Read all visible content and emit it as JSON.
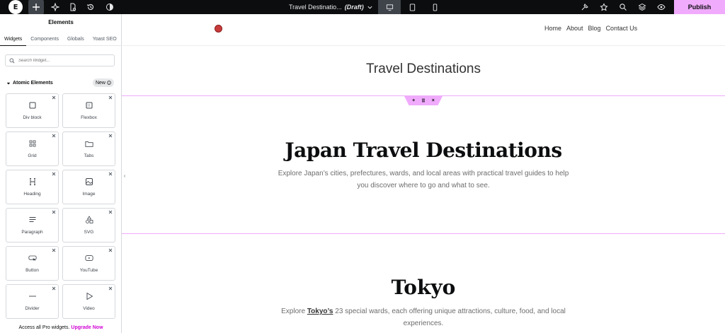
{
  "topbar": {
    "logo_icon": "elementor-logo-icon",
    "tools": [
      "add-element-icon",
      "ai-sparkle-icon",
      "page-settings-icon",
      "history-icon",
      "theme-contrast-icon"
    ],
    "document_title": "Travel Destinatio...",
    "document_status": "(Draft)",
    "devices": [
      "desktop-icon",
      "tablet-icon",
      "mobile-icon"
    ],
    "right_tools": [
      "hammer-icon",
      "integrations-icon",
      "search-icon",
      "structure-layers-icon",
      "preview-eye-icon"
    ],
    "publish_label": "Publish",
    "accent": "#f0abfc"
  },
  "panel": {
    "title": "Elements",
    "tabs": [
      "Widgets",
      "Components",
      "Globals",
      "Yoast SEO"
    ],
    "active_tab": "Widgets",
    "search_placeholder": "Search Widget...",
    "category_label": "Atomic Elements",
    "new_badge": "New",
    "widgets": [
      {
        "label": "Div block",
        "icon": "div-block-icon"
      },
      {
        "label": "Flexbox",
        "icon": "flexbox-icon"
      },
      {
        "label": "Grid",
        "icon": "grid-icon"
      },
      {
        "label": "Tabs",
        "icon": "tabs-icon"
      },
      {
        "label": "Heading",
        "icon": "heading-icon"
      },
      {
        "label": "Image",
        "icon": "image-icon"
      },
      {
        "label": "Paragraph",
        "icon": "paragraph-icon"
      },
      {
        "label": "SVG",
        "icon": "svg-icon"
      },
      {
        "label": "Button",
        "icon": "button-icon"
      },
      {
        "label": "YouTube",
        "icon": "youtube-icon"
      },
      {
        "label": "Divider",
        "icon": "divider-icon"
      },
      {
        "label": "Video",
        "icon": "video-icon"
      }
    ],
    "footer_text": "Access all Pro widgets.",
    "footer_link": "Upgrade Now"
  },
  "site": {
    "nav": [
      "Home",
      "About",
      "Blog",
      "Contact Us"
    ],
    "page_title": "Travel Destinations",
    "hero_title": "Japan Travel Destinations",
    "hero_text": "Explore Japan’s cities, prefectures, wards, and local areas with practical travel guides to help you discover where to go and what to see.",
    "section_title": "Tokyo",
    "section_text_before": "Explore",
    "section_link": "Tokyo’s",
    "section_text_after": "23 special wards, each offering unique attractions, culture, food, and local experiences."
  }
}
